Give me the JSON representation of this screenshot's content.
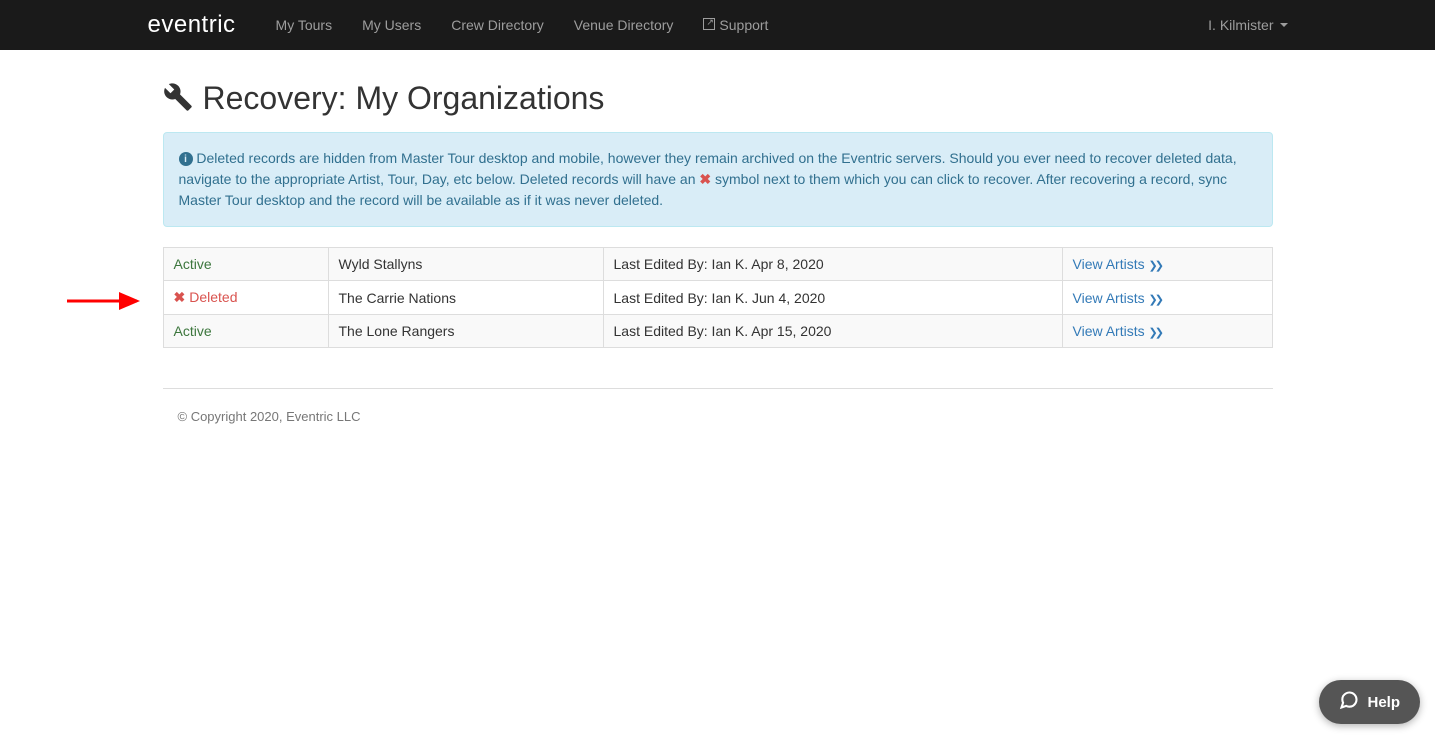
{
  "brand": "eventric",
  "nav": {
    "items": [
      {
        "label": "My Tours"
      },
      {
        "label": "My Users"
      },
      {
        "label": "Crew Directory"
      },
      {
        "label": "Venue Directory"
      },
      {
        "label": "Support"
      }
    ],
    "user": "I. Kilmister"
  },
  "page": {
    "title": "Recovery: My Organizations"
  },
  "alert": {
    "text_1": "Deleted records are hidden from Master Tour desktop and mobile, however they remain archived on the Eventric servers. Should you ever need to recover deleted data, navigate to the appropriate Artist, Tour, Day, etc below. Deleted records will have an ",
    "text_2": " symbol next to them which you can click to recover. After recovering a record, sync Master Tour desktop and the record will be available as if it was never deleted."
  },
  "table": {
    "rows": [
      {
        "status": "Active",
        "deleted": false,
        "name": "Wyld Stallyns",
        "edited": "Last Edited By: Ian K. Apr 8, 2020",
        "action": "View Artists"
      },
      {
        "status": "Deleted",
        "deleted": true,
        "name": "The Carrie Nations",
        "edited": "Last Edited By: Ian K. Jun 4, 2020",
        "action": "View Artists"
      },
      {
        "status": "Active",
        "deleted": false,
        "name": "The Lone Rangers",
        "edited": "Last Edited By: Ian K. Apr 15, 2020",
        "action": "View Artists"
      }
    ]
  },
  "footer": {
    "copyright": "© Copyright 2020, Eventric LLC"
  },
  "help": {
    "label": "Help"
  }
}
